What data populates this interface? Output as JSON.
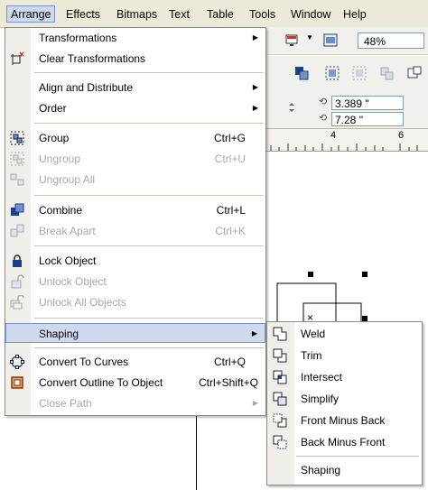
{
  "menubar": {
    "items": [
      {
        "label": "Arrange"
      },
      {
        "label": "Effects"
      },
      {
        "label": "Bitmaps"
      },
      {
        "label": "Text"
      },
      {
        "label": "Table"
      },
      {
        "label": "Tools"
      },
      {
        "label": "Window"
      },
      {
        "label": "Help"
      }
    ]
  },
  "toolbar": {
    "zoom_value": "48%"
  },
  "property_bar": {
    "x_value": "3.389 \"",
    "y_value": "7.28 \""
  },
  "ruler": {
    "labels": [
      "4",
      "6"
    ]
  },
  "arrange_menu": {
    "items": [
      {
        "label": "Transformations",
        "shortcut": "",
        "submenu": true,
        "enabled": true,
        "icon": ""
      },
      {
        "label": "Clear Transformations",
        "shortcut": "",
        "submenu": false,
        "enabled": true,
        "icon": "clear-transform-icon"
      },
      {
        "label": "Align and Distribute",
        "shortcut": "",
        "submenu": true,
        "enabled": true,
        "icon": ""
      },
      {
        "label": "Order",
        "shortcut": "",
        "submenu": true,
        "enabled": true,
        "icon": ""
      },
      {
        "label": "Group",
        "shortcut": "Ctrl+G",
        "submenu": false,
        "enabled": true,
        "icon": "group-icon"
      },
      {
        "label": "Ungroup",
        "shortcut": "Ctrl+U",
        "submenu": false,
        "enabled": false,
        "icon": "ungroup-icon"
      },
      {
        "label": "Ungroup All",
        "shortcut": "",
        "submenu": false,
        "enabled": false,
        "icon": "ungroup-all-icon"
      },
      {
        "label": "Combine",
        "shortcut": "Ctrl+L",
        "submenu": false,
        "enabled": true,
        "icon": "combine-icon"
      },
      {
        "label": "Break Apart",
        "shortcut": "Ctrl+K",
        "submenu": false,
        "enabled": false,
        "icon": "break-apart-icon"
      },
      {
        "label": "Lock Object",
        "shortcut": "",
        "submenu": false,
        "enabled": true,
        "icon": "lock-icon"
      },
      {
        "label": "Unlock Object",
        "shortcut": "",
        "submenu": false,
        "enabled": false,
        "icon": "unlock-icon"
      },
      {
        "label": "Unlock All Objects",
        "shortcut": "",
        "submenu": false,
        "enabled": false,
        "icon": "unlock-all-icon"
      },
      {
        "label": "Shaping",
        "shortcut": "",
        "submenu": true,
        "enabled": true,
        "icon": ""
      },
      {
        "label": "Convert To Curves",
        "shortcut": "Ctrl+Q",
        "submenu": false,
        "enabled": true,
        "icon": "convert-curves-icon"
      },
      {
        "label": "Convert Outline To Object",
        "shortcut": "Ctrl+Shift+Q",
        "submenu": false,
        "enabled": true,
        "icon": "convert-outline-icon"
      },
      {
        "label": "Close Path",
        "shortcut": "",
        "submenu": true,
        "enabled": false,
        "icon": ""
      }
    ]
  },
  "shaping_submenu": {
    "items": [
      {
        "label": "Weld",
        "icon": "weld-icon"
      },
      {
        "label": "Trim",
        "icon": "trim-icon"
      },
      {
        "label": "Intersect",
        "icon": "intersect-icon"
      },
      {
        "label": "Simplify",
        "icon": "simplify-icon"
      },
      {
        "label": "Front Minus Back",
        "icon": "front-minus-back-icon"
      },
      {
        "label": "Back Minus Front",
        "icon": "back-minus-front-icon"
      },
      {
        "label": "Shaping",
        "icon": ""
      }
    ]
  },
  "colors": {
    "highlight": "#cfd9ee",
    "highlight_border": "#7b93c6",
    "menubar": "#ece9d8",
    "disabled_text": "#a8a8a8"
  }
}
